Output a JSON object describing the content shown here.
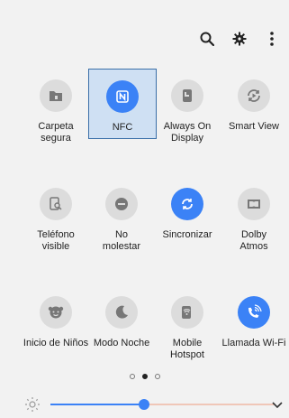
{
  "top_actions": [
    "search-icon",
    "gear-icon",
    "more-vert-icon"
  ],
  "colors": {
    "accent": "#3b82f6",
    "tile_off": "#dcdcdc",
    "selected_bg": "#cfe0f3"
  },
  "tiles": [
    {
      "label": "Carpeta\nsegura",
      "icon": "folder-lock-icon",
      "on": false
    },
    {
      "label": "NFC",
      "icon": "nfc-icon",
      "on": true,
      "selected": true
    },
    {
      "label": "Always On\nDisplay",
      "icon": "phone-display-icon",
      "on": false
    },
    {
      "label": "Smart View",
      "icon": "smart-view-icon",
      "on": false
    },
    {
      "label": "Teléfono\nvisible",
      "icon": "phone-search-icon",
      "on": false
    },
    {
      "label": "No\nmolestar",
      "icon": "do-not-disturb-icon",
      "on": false
    },
    {
      "label": "Sincronizar",
      "icon": "sync-icon",
      "on": true
    },
    {
      "label": "Dolby\nAtmos",
      "icon": "dolby-icon",
      "on": false
    },
    {
      "label": "Inicio de Niños",
      "icon": "kids-icon",
      "on": false
    },
    {
      "label": "Modo Noche",
      "icon": "moon-icon",
      "on": false
    },
    {
      "label": "Mobile\nHotspot",
      "icon": "hotspot-icon",
      "on": false
    },
    {
      "label": "Llamada Wi-Fi",
      "icon": "wifi-call-icon",
      "on": true
    }
  ],
  "pager": {
    "pages": 3,
    "active": 1
  },
  "brightness": {
    "level": 0.42
  }
}
